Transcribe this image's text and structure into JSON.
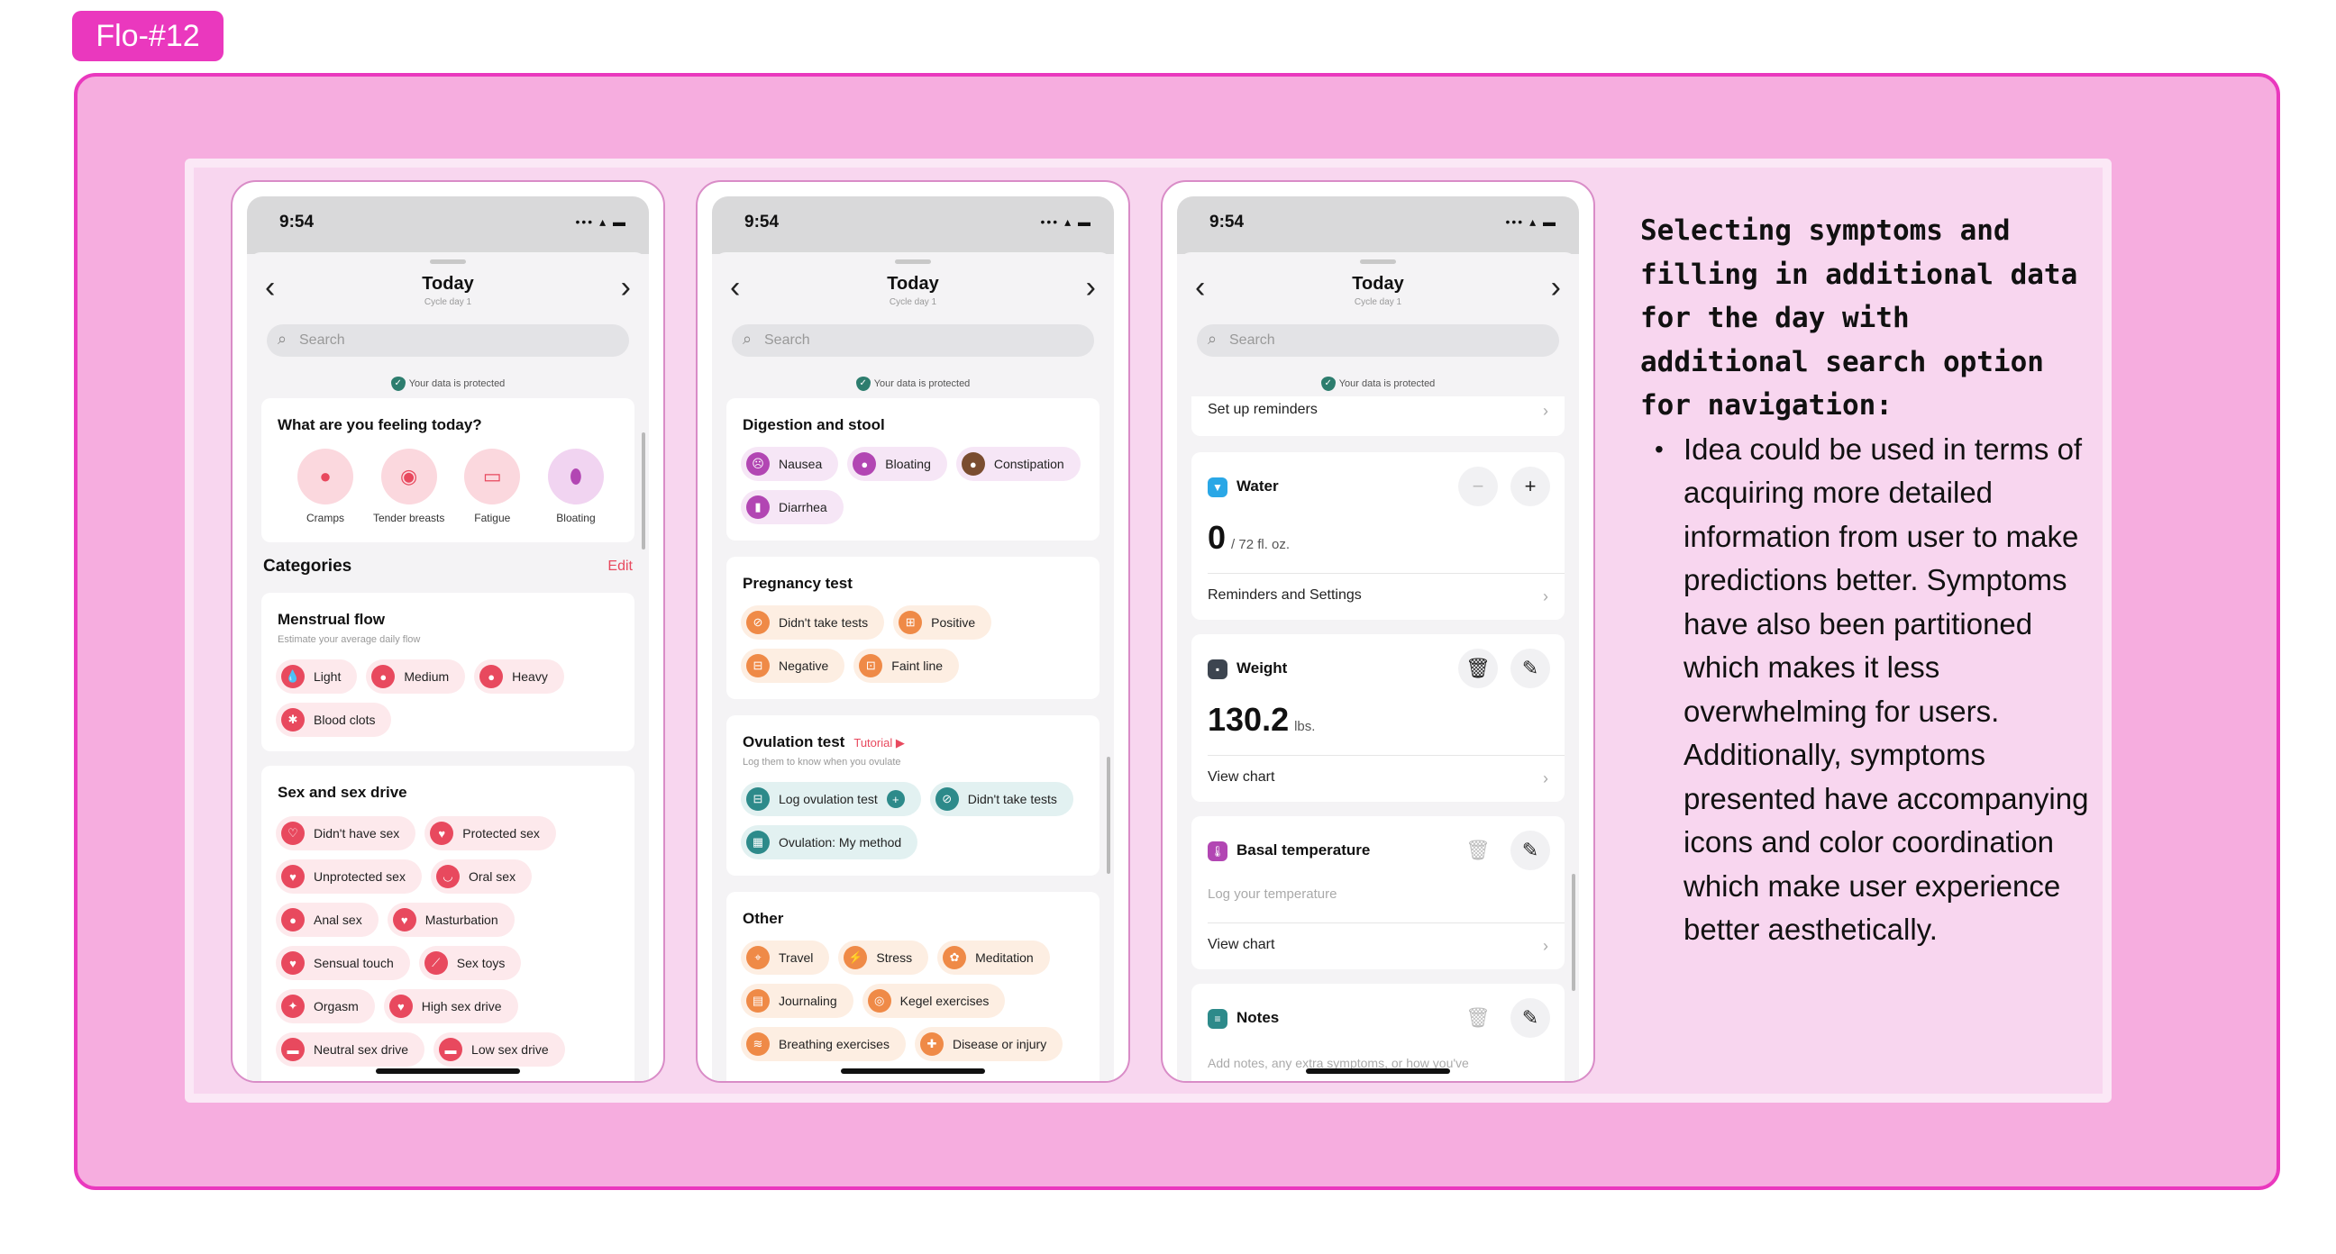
{
  "tag": "Flo-#12",
  "common": {
    "time": "9:54",
    "signal": "••• ▴ ▬",
    "nav_back": "‹",
    "nav_forward": "›",
    "title": "Today",
    "subtitle": "Cycle day 1",
    "search_placeholder": "Search",
    "protected": "Your data is protected"
  },
  "screen1": {
    "feeling_title": "What are you feeling today?",
    "feelings": [
      "Cramps",
      "Tender breasts",
      "Fatigue",
      "Bloating"
    ],
    "categories": "Categories",
    "edit": "Edit",
    "menstrual": {
      "title": "Menstrual flow",
      "subtitle": "Estimate your average daily flow",
      "chips": [
        "Light",
        "Medium",
        "Heavy",
        "Blood clots"
      ]
    },
    "sex": {
      "title": "Sex and sex drive",
      "chips": [
        "Didn't have sex",
        "Protected sex",
        "Unprotected sex",
        "Oral sex",
        "Anal sex",
        "Masturbation",
        "Sensual touch",
        "Sex toys",
        "Orgasm",
        "High sex drive",
        "Neutral sex drive",
        "Low sex drive"
      ]
    }
  },
  "screen2": {
    "digestion": {
      "title": "Digestion and stool",
      "chips": [
        "Nausea",
        "Bloating",
        "Constipation",
        "Diarrhea"
      ]
    },
    "pregnancy": {
      "title": "Pregnancy test",
      "chips": [
        "Didn't take tests",
        "Positive",
        "Negative",
        "Faint line"
      ]
    },
    "ovulation": {
      "title": "Ovulation test",
      "tutorial": "Tutorial",
      "subtitle": "Log them to know when you ovulate",
      "chips": [
        "Log ovulation test",
        "Didn't take tests",
        "Ovulation: My method"
      ]
    },
    "other": {
      "title": "Other",
      "chips": [
        "Travel",
        "Stress",
        "Meditation",
        "Journaling",
        "Kegel exercises",
        "Breathing exercises",
        "Disease or injury"
      ]
    }
  },
  "screen3": {
    "reminders": "Set up reminders",
    "water": {
      "title": "Water",
      "value": "0",
      "unit": "/ 72 fl. oz.",
      "link": "Reminders and Settings"
    },
    "weight": {
      "title": "Weight",
      "value": "130.2",
      "unit": "lbs.",
      "link": "View chart"
    },
    "basal": {
      "title": "Basal temperature",
      "placeholder": "Log your temperature",
      "link": "View chart"
    },
    "notes": {
      "title": "Notes",
      "placeholder": "Add notes, any extra symptoms, or how you've"
    }
  },
  "description": {
    "heading": "Selecting symptoms and filling in additional data for the day with additional search option for navigation:",
    "bullet": "Idea could be used in terms of acquiring more detailed information from user to make predictions better. Symptoms have also been partitioned which makes it less overwhelming for users. Additionally, symptoms presented have accompanying icons and color coordination which make user experience better aesthetically."
  },
  "colors": {
    "accent": "#ea38be",
    "frame_bg": "#f6addf",
    "panel_bg": "#f8d6ef",
    "red": "#e8495e",
    "purple": "#b246b3",
    "orange": "#ef8a47",
    "teal": "#2d8a8a"
  },
  "icons": [
    "back-chevron-icon",
    "forward-chevron-icon",
    "search-icon",
    "shield-icon",
    "drop-icon",
    "trash-icon",
    "pencil-icon",
    "plus-icon",
    "minus-icon",
    "water-cup-icon",
    "scale-icon",
    "thermometer-icon",
    "notes-icon"
  ]
}
